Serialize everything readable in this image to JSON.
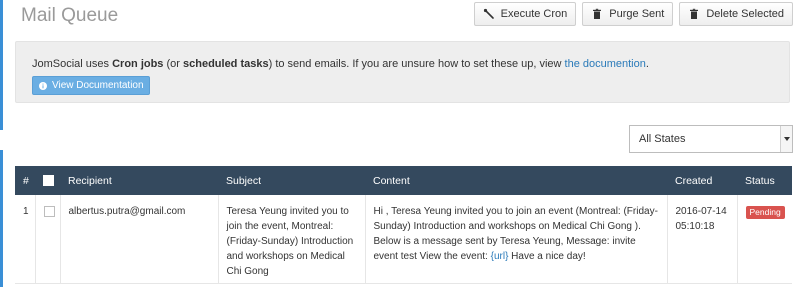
{
  "header": {
    "title": "Mail Queue",
    "buttons": {
      "execute_cron": "Execute Cron",
      "purge_sent": "Purge Sent",
      "delete_selected": "Delete Selected"
    }
  },
  "info": {
    "text_1": "JomSocial uses ",
    "bold_1": "Cron jobs",
    "text_2": " (or ",
    "bold_2": "scheduled tasks",
    "text_3": ") to send emails. If you are unsure how to set these up, view ",
    "link": "the documention",
    "text_4": ".",
    "doc_button": "View Documentation"
  },
  "filter": {
    "selected": "All States"
  },
  "table": {
    "headers": {
      "num": "#",
      "recipient": "Recipient",
      "subject": "Subject",
      "content": "Content",
      "created": "Created",
      "status": "Status"
    },
    "rows": [
      {
        "num": "1",
        "recipient": "albertus.putra@gmail.com",
        "subject": "Teresa Yeung invited you to join the event, Montreal: (Friday-Sunday) Introduction and workshops on Medical Chi Gong",
        "content_1": "Hi , Teresa Yeung invited you to join an event (Montreal: (Friday-Sunday) Introduction and workshops on Medical Chi Gong ). Below is a message sent by Teresa Yeung, Message: invite event test View the event: ",
        "content_url": "{url}",
        "content_2": " Have a nice day!",
        "created": "2016-07-14 05:10:18",
        "status": "Pending"
      }
    ]
  },
  "colors": {
    "header_bg": "#34495e",
    "accent": "#3a8fd6",
    "pending": "#d9534f",
    "doc_button": "#6aaee3"
  }
}
